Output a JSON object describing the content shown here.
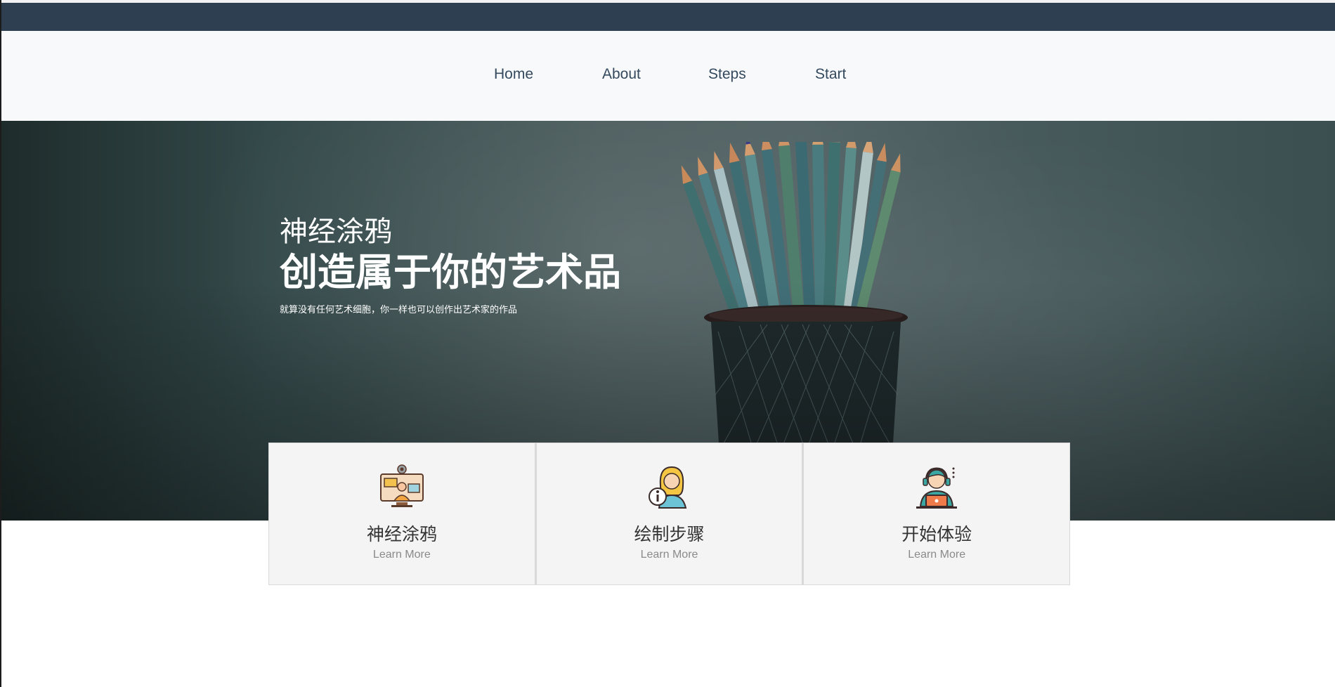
{
  "nav": {
    "items": [
      {
        "label": "Home"
      },
      {
        "label": "About"
      },
      {
        "label": "Steps"
      },
      {
        "label": "Start"
      }
    ]
  },
  "hero": {
    "subtitle": "神经涂鸦",
    "title": "创造属于你的艺术品",
    "description": "就算没有任何艺术细胞，你一样也可以创作出艺术家的作品"
  },
  "cards": [
    {
      "title": "神经涂鸦",
      "link": "Learn More",
      "icon": "video-conference-icon"
    },
    {
      "title": "绘制步骤",
      "link": "Learn More",
      "icon": "support-info-icon"
    },
    {
      "title": "开始体验",
      "link": "Learn More",
      "icon": "headset-operator-icon"
    }
  ],
  "colors": {
    "top_bar": "#2e3f51",
    "nav_bg": "#f8f9fa",
    "nav_text": "#34495e",
    "card_bg": "#f4f4f4"
  }
}
